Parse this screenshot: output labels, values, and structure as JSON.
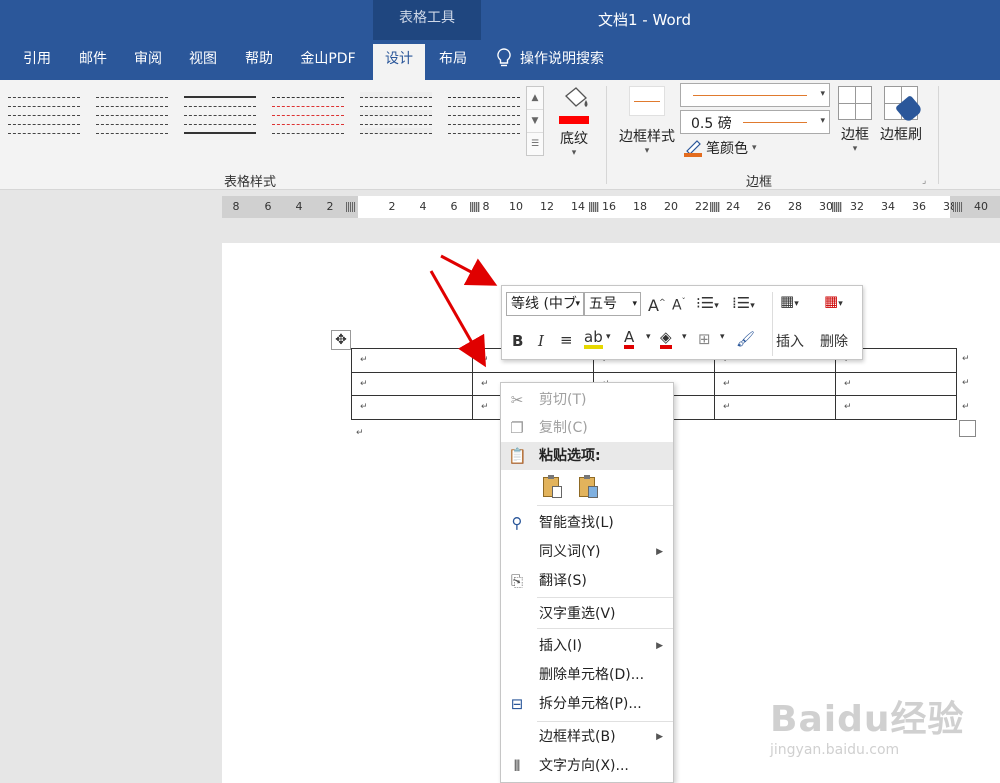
{
  "window": {
    "context_group": "表格工具",
    "title": "文档1 - Word"
  },
  "tabs": [
    {
      "label": "引用"
    },
    {
      "label": "邮件"
    },
    {
      "label": "审阅"
    },
    {
      "label": "视图"
    },
    {
      "label": "帮助"
    },
    {
      "label": "金山PDF"
    },
    {
      "label": "设计",
      "active": true
    },
    {
      "label": "布局"
    }
  ],
  "tell_me": "操作说明搜索",
  "ribbon": {
    "table_styles_label": "表格样式",
    "shading_label": "底纹",
    "shading_color": "#ff0000",
    "border_styles_label": "边框样式",
    "line_weight": "0.5 磅",
    "pen_color_label": "笔颜色",
    "borders_group_label": "边框",
    "borders_button": "边框",
    "border_painter": "边框刷",
    "accent_line_color": "#e07a2e"
  },
  "ruler": {
    "ticks": [
      "8",
      "6",
      "4",
      "2",
      "2",
      "4",
      "6",
      "8",
      "10",
      "12",
      "14",
      "16",
      "18",
      "20",
      "22",
      "24",
      "26",
      "28",
      "30",
      "32",
      "34",
      "36",
      "38",
      "40"
    ]
  },
  "document": {
    "paragraph_mark": "↵",
    "table": {
      "rows": 3,
      "cols": 5,
      "cells": [
        [
          "↵",
          "↵",
          "↵",
          "↵",
          "↵"
        ],
        [
          "↵",
          "↵",
          "↵",
          "↵",
          "↵"
        ],
        [
          "↵",
          "↵",
          "↵",
          "↵",
          "↵"
        ]
      ]
    }
  },
  "mini_toolbar": {
    "font_name": "等线 (中ブ",
    "font_size": "五号",
    "grow_font": "A",
    "shrink_font": "A",
    "bold": "B",
    "italic": "I",
    "font_color_glyph": "A",
    "insert_label": "插入",
    "delete_label": "删除",
    "highlight_color": "#e6d800",
    "font_color": "#e00000",
    "shading_color": "#e00000"
  },
  "context_menu": {
    "items": [
      {
        "label": "剪切(T)",
        "disabled": true
      },
      {
        "label": "复制(C)",
        "disabled": true
      },
      {
        "label": "粘贴选项:",
        "header": true
      },
      {
        "label": "智能查找(L)"
      },
      {
        "label": "同义词(Y)",
        "submenu": true
      },
      {
        "label": "翻译(S)"
      },
      {
        "label": "汉字重选(V)"
      },
      {
        "label": "插入(I)",
        "submenu": true
      },
      {
        "label": "删除单元格(D)..."
      },
      {
        "label": "拆分单元格(P)..."
      },
      {
        "label": "边框样式(B)",
        "submenu": true
      },
      {
        "label": "文字方向(X)..."
      }
    ]
  },
  "watermark": {
    "brand": "Baidu经验",
    "url": "jingyan.baidu.com"
  }
}
